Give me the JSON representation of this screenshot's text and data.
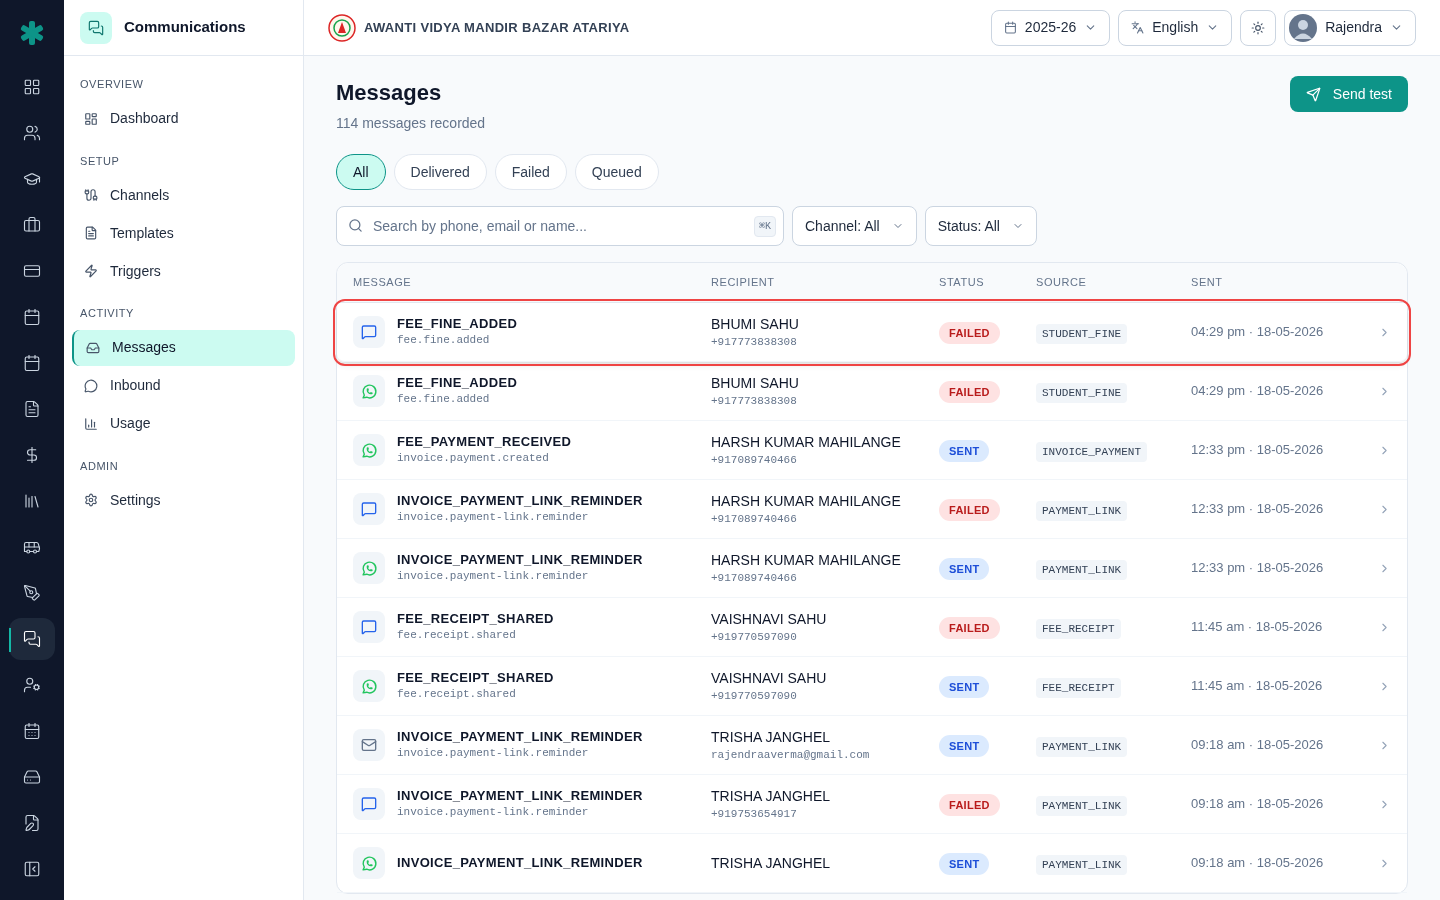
{
  "rail": [
    {
      "selected": false
    },
    {
      "selected": false
    },
    {
      "selected": false
    },
    {
      "selected": false
    },
    {
      "selected": false
    },
    {
      "selected": false
    },
    {
      "selected": false
    },
    {
      "selected": false
    },
    {
      "selected": false
    },
    {
      "selected": false
    },
    {
      "selected": false
    },
    {
      "selected": false
    },
    {
      "selected": true
    },
    {
      "selected": false
    },
    {
      "selected": false
    },
    {
      "selected": false
    },
    {
      "selected": false
    }
  ],
  "sidebar": {
    "title": "Communications",
    "sections": [
      {
        "heading": "OVERVIEW",
        "items": [
          {
            "label": "Dashboard",
            "selected": false
          }
        ]
      },
      {
        "heading": "SETUP",
        "items": [
          {
            "label": "Channels",
            "selected": false
          },
          {
            "label": "Templates",
            "selected": false
          },
          {
            "label": "Triggers",
            "selected": false
          }
        ]
      },
      {
        "heading": "ACTIVITY",
        "items": [
          {
            "label": "Messages",
            "selected": true
          },
          {
            "label": "Inbound",
            "selected": false
          },
          {
            "label": "Usage",
            "selected": false
          }
        ]
      },
      {
        "heading": "ADMIN",
        "items": [
          {
            "label": "Settings",
            "selected": false
          }
        ]
      }
    ]
  },
  "header": {
    "school": "AWANTI VIDYA MANDIR BAZAR ATARIYA",
    "year": "2025-26",
    "language": "English",
    "user": "Rajendra"
  },
  "page": {
    "title": "Messages",
    "subtitle": "114 messages recorded",
    "action": "Send test"
  },
  "filters": [
    {
      "label": "All",
      "selected": true
    },
    {
      "label": "Delivered",
      "selected": false
    },
    {
      "label": "Failed",
      "selected": false
    },
    {
      "label": "Queued",
      "selected": false
    }
  ],
  "search": {
    "placeholder": "Search by phone, email or name...",
    "shortcut": "⌘K"
  },
  "dropdowns": [
    "Channel: All",
    "Status: All"
  ],
  "table": {
    "columns": [
      "MESSAGE",
      "RECIPIENT",
      "STATUS",
      "SOURCE",
      "SENT"
    ],
    "rows": [
      {
        "kind": "sms",
        "name": "FEE_FINE_ADDED",
        "event": "fee.fine.added",
        "recipient": "BHUMI SAHU",
        "contact": "+917773838308",
        "status": "FAILED",
        "source": "STUDENT_FINE",
        "sent": "04:29 pm · 18-05-2026",
        "selected": true
      },
      {
        "kind": "whatsapp",
        "name": "FEE_FINE_ADDED",
        "event": "fee.fine.added",
        "recipient": "BHUMI SAHU",
        "contact": "+917773838308",
        "status": "FAILED",
        "source": "STUDENT_FINE",
        "sent": "04:29 pm · 18-05-2026",
        "selected": false
      },
      {
        "kind": "whatsapp",
        "name": "FEE_PAYMENT_RECEIVED",
        "event": "invoice.payment.created",
        "recipient": "HARSH KUMAR MAHILANGE",
        "contact": "+917089740466",
        "status": "SENT",
        "source": "INVOICE_PAYMENT",
        "sent": "12:33 pm · 18-05-2026",
        "selected": false
      },
      {
        "kind": "sms",
        "name": "INVOICE_PAYMENT_LINK_REMINDER",
        "event": "invoice.payment-link.reminder",
        "recipient": "HARSH KUMAR MAHILANGE",
        "contact": "+917089740466",
        "status": "FAILED",
        "source": "PAYMENT_LINK",
        "sent": "12:33 pm · 18-05-2026",
        "selected": false
      },
      {
        "kind": "whatsapp",
        "name": "INVOICE_PAYMENT_LINK_REMINDER",
        "event": "invoice.payment-link.reminder",
        "recipient": "HARSH KUMAR MAHILANGE",
        "contact": "+917089740466",
        "status": "SENT",
        "source": "PAYMENT_LINK",
        "sent": "12:33 pm · 18-05-2026",
        "selected": false
      },
      {
        "kind": "sms",
        "name": "FEE_RECEIPT_SHARED",
        "event": "fee.receipt.shared",
        "recipient": "VAISHNAVI SAHU",
        "contact": "+919770597090",
        "status": "FAILED",
        "source": "FEE_RECEIPT",
        "sent": "11:45 am · 18-05-2026",
        "selected": false
      },
      {
        "kind": "whatsapp",
        "name": "FEE_RECEIPT_SHARED",
        "event": "fee.receipt.shared",
        "recipient": "VAISHNAVI SAHU",
        "contact": "+919770597090",
        "status": "SENT",
        "source": "FEE_RECEIPT",
        "sent": "11:45 am · 18-05-2026",
        "selected": false
      },
      {
        "kind": "email",
        "name": "INVOICE_PAYMENT_LINK_REMINDER",
        "event": "invoice.payment-link.reminder",
        "recipient": "TRISHA JANGHEL",
        "contact": "rajendraaverma@gmail.com",
        "status": "SENT",
        "source": "PAYMENT_LINK",
        "sent": "09:18 am · 18-05-2026",
        "selected": false
      },
      {
        "kind": "sms",
        "name": "INVOICE_PAYMENT_LINK_REMINDER",
        "event": "invoice.payment-link.reminder",
        "recipient": "TRISHA JANGHEL",
        "contact": "+919753654917",
        "status": "FAILED",
        "source": "PAYMENT_LINK",
        "sent": "09:18 am · 18-05-2026",
        "selected": false
      },
      {
        "kind": "whatsapp",
        "name": "INVOICE_PAYMENT_LINK_REMINDER",
        "recipient": "TRISHA JANGHEL",
        "status": "SENT",
        "source": "PAYMENT_LINK",
        "sent": "09:18 am · 18-05-2026",
        "selected": false
      }
    ]
  }
}
